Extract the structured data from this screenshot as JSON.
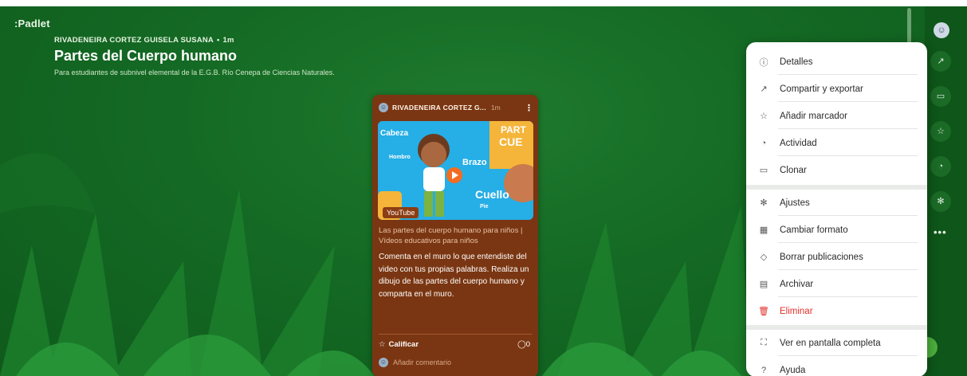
{
  "app": {
    "brand": ":Padlet"
  },
  "board": {
    "author": "RIVADENEIRA CORTEZ GUISELA SUSANA",
    "age": "1m",
    "title": "Partes del Cuerpo humano",
    "subtitle": "Para estudiantes de subnivel elemental de la E.G.B. Río Cenepa de Ciencias Naturales."
  },
  "post": {
    "author": "RIVADENEIRA CORTEZ G...",
    "age": "1m",
    "video_badge": "YouTube",
    "thumb_labels": {
      "cabeza": "Cabeza",
      "hombro": "Hombro",
      "brazo": "Brazo",
      "cuello": "Cuello",
      "pie": "Pie",
      "partes": "PART",
      "cue": "CUE"
    },
    "link_title": "Las partes del cuerpo humano para niños | Vídeos educativos para niños",
    "body": "Comenta en el muro lo que entendiste del video con tus propias palabras. Realiza un dibujo de las partes del cuerpo humano y comparta en el muro.",
    "rate_label": "Calificar",
    "comment_count": "0",
    "add_comment": "Añadir comentario"
  },
  "menu": {
    "items": [
      {
        "label": "Detalles",
        "icon": "info-icon"
      },
      {
        "label": "Compartir y exportar",
        "icon": "share-icon"
      },
      {
        "label": "Añadir marcador",
        "icon": "star-icon"
      },
      {
        "label": "Actividad",
        "icon": "bell-icon"
      },
      {
        "label": "Clonar",
        "icon": "clone-icon"
      },
      {
        "label": "Ajustes",
        "icon": "gear-icon"
      },
      {
        "label": "Cambiar formato",
        "icon": "layout-icon"
      },
      {
        "label": "Borrar publicaciones",
        "icon": "eraser-icon"
      },
      {
        "label": "Archivar",
        "icon": "archive-icon"
      },
      {
        "label": "Eliminar",
        "icon": "trash-icon"
      },
      {
        "label": "Ver en pantalla completa",
        "icon": "fullscreen-icon"
      },
      {
        "label": "Ayuda",
        "icon": "help-icon"
      }
    ]
  },
  "colors": {
    "background": "#146a24",
    "card": "#7a3612",
    "danger": "#e0312b"
  }
}
